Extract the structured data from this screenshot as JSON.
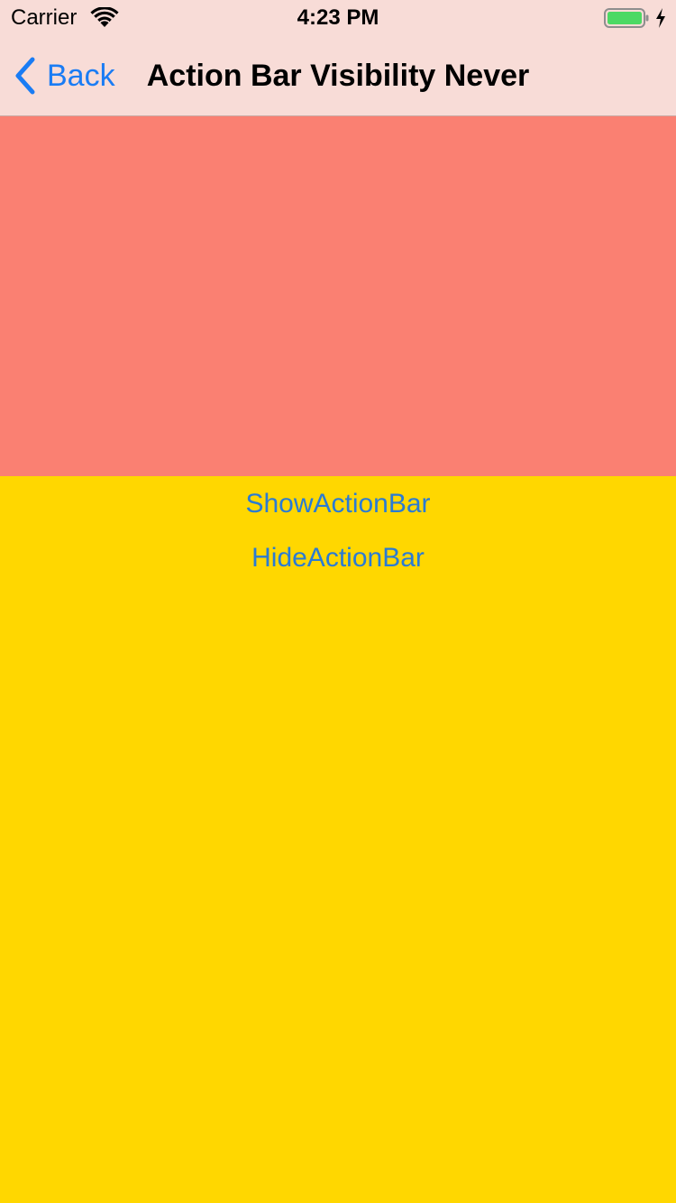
{
  "status_bar": {
    "carrier": "Carrier",
    "time": "4:23 PM",
    "wifi_icon": "wifi-icon",
    "battery_icon": "battery-icon",
    "charging_icon": "bolt-icon",
    "battery_level": 1.0,
    "battery_color": "#4CD964"
  },
  "nav_bar": {
    "back_label": "Back",
    "back_icon": "chevron-left-icon",
    "title": "Action Bar Visibility Never",
    "background": "#F8DCD7",
    "tint": "#1A7CF4"
  },
  "content": {
    "block_color": "#FA8072",
    "page_color": "#FFD700",
    "buttons": [
      {
        "label": "ShowActionBar"
      },
      {
        "label": "HideActionBar"
      }
    ]
  }
}
